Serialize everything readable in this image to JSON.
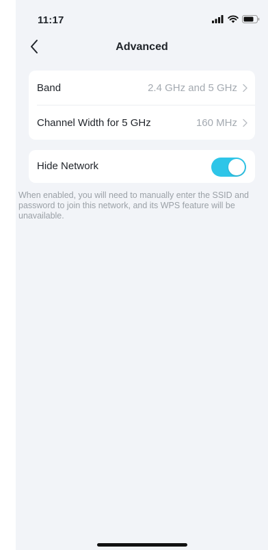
{
  "status_bar": {
    "time": "11:17",
    "icons": [
      "signal-icon",
      "wifi-icon",
      "battery-icon"
    ]
  },
  "header": {
    "title": "Advanced",
    "back_icon": "chevron-left-icon"
  },
  "settings": {
    "band": {
      "label": "Band",
      "value": "2.4 GHz and 5 GHz"
    },
    "channel_width": {
      "label": "Channel Width for 5 GHz",
      "value": "160 MHz"
    },
    "hide_network": {
      "label": "Hide Network",
      "enabled": true
    }
  },
  "note": "When enabled, you will need to manually enter the SSID and password to join this network, and its WPS feature will be unavailable.",
  "colors": {
    "accent": "#2ec5e8",
    "background": "#f2f4f8",
    "card": "#ffffff",
    "secondary_text": "#a3a9b0"
  }
}
